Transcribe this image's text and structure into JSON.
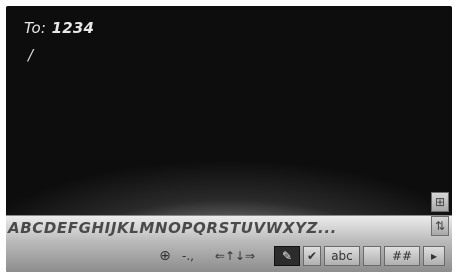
{
  "message": {
    "to_prefix": "To:",
    "recipient": "1234",
    "cursor": "/"
  },
  "keyboard": {
    "letters": "ABCDEFGHIJKLMNOPQRSTUVWXYZ",
    "more": "...",
    "side_buttons": [
      {
        "icon": "grid-icon",
        "glyph": "⊞"
      },
      {
        "icon": "case-toggle-icon",
        "glyph": "⇅"
      }
    ],
    "controls": [
      {
        "icon": "globe-icon",
        "glyph": "⊕"
      },
      {
        "label": "-.,"
      },
      {
        "icon": "shift-arrows-icon",
        "glyph": "⇐↑↓⇒"
      },
      {
        "icon": "edit-icon",
        "glyph": "✎"
      },
      {
        "icon": "check-icon",
        "glyph": "✔"
      },
      {
        "label": "abc"
      },
      {
        "icon": "blank-key-icon",
        "glyph": ""
      },
      {
        "icon": "numeric-icon",
        "glyph": "##"
      },
      {
        "icon": "arrow-right-icon",
        "glyph": "▸"
      }
    ]
  }
}
